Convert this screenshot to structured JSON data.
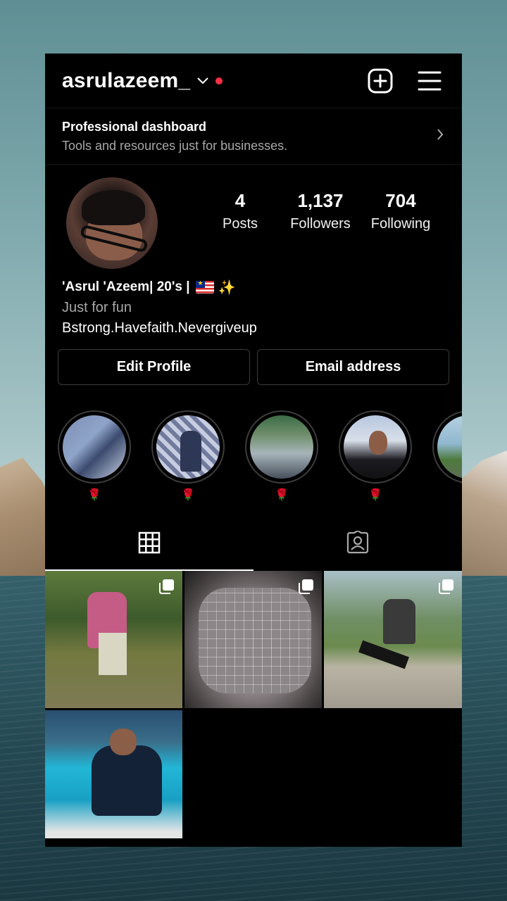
{
  "header": {
    "username": "asrulazeem_",
    "has_notification_dot": true,
    "icons": [
      "create-post-icon",
      "menu-icon"
    ]
  },
  "dashboard": {
    "title": "Professional dashboard",
    "subtitle": "Tools and resources just for businesses."
  },
  "stats": {
    "posts_count": "4",
    "posts_label": "Posts",
    "followers_count": "1,137",
    "followers_label": "Followers",
    "following_count": "704",
    "following_label": "Following"
  },
  "bio": {
    "name_line": "'Asrul 'Azeem| 20's |",
    "line2": "Just for fun",
    "line3": "Bstrong.Havefaith.Nevergiveup"
  },
  "buttons": {
    "edit_profile": "Edit Profile",
    "email_address": "Email address"
  },
  "highlights": [
    {
      "label": "🌹"
    },
    {
      "label": "🌹"
    },
    {
      "label": "🌹"
    },
    {
      "label": "🌹"
    },
    {
      "label": ""
    }
  ],
  "tabs": [
    "grid-icon",
    "tagged-icon"
  ],
  "colors": {
    "background": "#000000",
    "accent_red": "#ff3040",
    "text_secondary": "#a8a8a8"
  }
}
